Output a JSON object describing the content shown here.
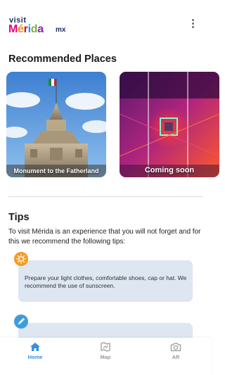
{
  "brand": {
    "visit": "visit",
    "merida": [
      "M",
      "é",
      "r",
      "i",
      "d",
      "a"
    ],
    "merida_colors": [
      "#e6007e",
      "#f39200",
      "#e30613",
      "#00a0e3",
      "#7cb342",
      "#8e24aa"
    ],
    "mx": "mx"
  },
  "header": {
    "menu_icon": "more-vertical-icon"
  },
  "recommended": {
    "title": "Recommended Places",
    "cards": [
      {
        "label": "Monument to the Fatherland"
      },
      {
        "label": "Coming soon"
      }
    ]
  },
  "tips": {
    "title": "Tips",
    "intro": "To visit Mérida is an experience that you will not forget and for this we recommend the following tips:",
    "items": [
      {
        "icon": "sun-icon",
        "color": "#f39a1f",
        "text": "Prepare your light clothes, comfortable shoes, cap or hat. We recommend the use of sunscreen."
      },
      {
        "icon": "pen-icon",
        "color": "#3d9ddc",
        "text": ""
      }
    ]
  },
  "nav": {
    "active_color": "#3a8edb",
    "items": [
      {
        "label": "Home",
        "icon": "home-icon",
        "active": true
      },
      {
        "label": "Map",
        "icon": "map-icon",
        "active": false
      },
      {
        "label": "AR",
        "icon": "camera-icon",
        "active": false
      }
    ]
  }
}
